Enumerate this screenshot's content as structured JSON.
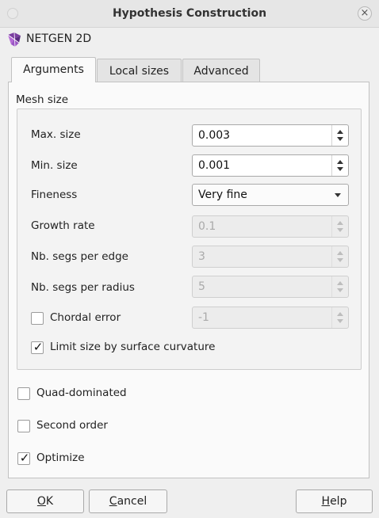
{
  "window": {
    "title": "Hypothesis Construction"
  },
  "hypothesis": {
    "name": "NETGEN 2D",
    "icon": "netgen-hypothesis-icon"
  },
  "tabs": [
    {
      "label": "Arguments",
      "active": true
    },
    {
      "label": "Local sizes",
      "active": false
    },
    {
      "label": "Advanced",
      "active": false
    }
  ],
  "mesh_size": {
    "title": "Mesh size",
    "max_size": {
      "label": "Max. size",
      "value": "0.003",
      "enabled": true
    },
    "min_size": {
      "label": "Min. size",
      "value": "0.001",
      "enabled": true
    },
    "fineness": {
      "label": "Fineness",
      "value": "Very fine"
    },
    "growth_rate": {
      "label": "Growth rate",
      "value": "0.1",
      "enabled": false
    },
    "segs_per_edge": {
      "label": "Nb. segs per edge",
      "value": "3",
      "enabled": false
    },
    "segs_per_radius": {
      "label": "Nb. segs per radius",
      "value": "5",
      "enabled": false
    },
    "chordal_error": {
      "label": "Chordal error",
      "checked": false,
      "value": "-1",
      "enabled": false
    },
    "limit_curvature": {
      "label": "Limit size by surface curvature",
      "checked": true
    }
  },
  "options": {
    "quad_dominated": {
      "label": "Quad-dominated",
      "checked": false
    },
    "second_order": {
      "label": "Second order",
      "checked": false
    },
    "optimize": {
      "label": "Optimize",
      "checked": true
    }
  },
  "buttons": {
    "ok": {
      "mnemonic": "O",
      "rest": "K"
    },
    "cancel": {
      "mnemonic": "C",
      "rest": "ancel"
    },
    "help": {
      "mnemonic": "H",
      "rest": "elp"
    }
  },
  "check_glyph": "✓"
}
